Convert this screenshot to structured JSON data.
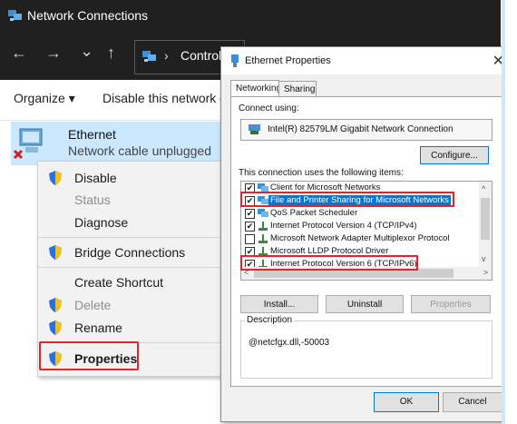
{
  "explorer": {
    "title": "Network Connections",
    "address_crumb": "Control",
    "nav": {
      "back": "←",
      "forward": "→",
      "dropdown": "⌄",
      "up": "↑",
      "sep": "›"
    },
    "toolbar": {
      "organize": "Organize ▾",
      "disable": "Disable this network d"
    },
    "item": {
      "name": "Ethernet",
      "status": "Network cable unplugged"
    }
  },
  "context_menu": {
    "items": [
      {
        "label": "Disable",
        "shield": true
      },
      {
        "label": "Status",
        "disabled": true
      },
      {
        "label": "Diagnose"
      },
      {
        "label": "Bridge Connections",
        "shield": true
      },
      {
        "label": "Create Shortcut"
      },
      {
        "label": "Delete",
        "shield": true,
        "disabled": true
      },
      {
        "label": "Rename",
        "shield": true
      },
      {
        "label": "Properties",
        "shield": true,
        "bold": true
      }
    ]
  },
  "dialog": {
    "title": "Ethernet   Properties",
    "close": "✕",
    "tabs": [
      "Networking",
      "Sharing"
    ],
    "connect_using_label": "Connect using:",
    "adapter_name": "Intel(R) 82579LM Gigabit Network Connection",
    "configure_button": "Configure...",
    "items_label": "This connection uses the following items:",
    "items": [
      {
        "label": "Client for Microsoft Networks",
        "checked": true
      },
      {
        "label": "File and Printer Sharing for Microsoft Networks",
        "checked": true,
        "selected": true
      },
      {
        "label": "QoS Packet Scheduler",
        "checked": true
      },
      {
        "label": "Internet Protocol Version 4 (TCP/IPv4)",
        "checked": true
      },
      {
        "label": "Microsoft Network Adapter Multiplexor Protocol",
        "checked": false
      },
      {
        "label": "Microsoft LLDP Protocol Driver",
        "checked": true
      },
      {
        "label": "Internet Protocol Version 6 (TCP/IPv6)",
        "checked": true
      }
    ],
    "install_button": "Install...",
    "uninstall_button": "Uninstall",
    "properties_button": "Properties",
    "description_label": "Description",
    "description_text": "@netcfgx.dll,-50003",
    "ok_button": "OK",
    "cancel_button": "Cancel"
  },
  "colors": {
    "highlight_red": "#e0262b",
    "selection_blue": "#0078d7",
    "item_hover": "#cce8ff",
    "titlebar_dark": "#202020"
  }
}
